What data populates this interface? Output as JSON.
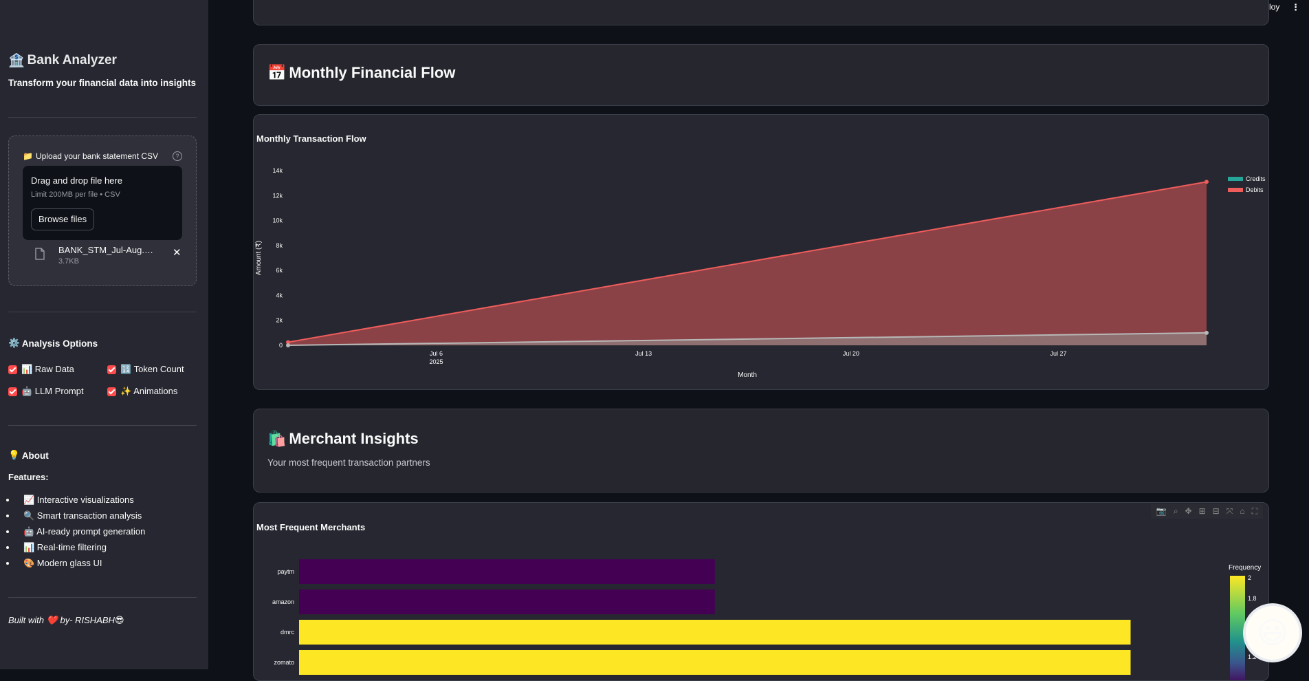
{
  "app": {
    "deploy_label": "Deploy",
    "menu_icon": "⋮"
  },
  "sidebar": {
    "title_icon": "🏦",
    "title": "Bank Analyzer",
    "subtitle": "Transform your financial data into insights",
    "uploader": {
      "label_icon": "📁",
      "label": "Upload your bank statement CSV",
      "help_icon": "?",
      "drop_title": "Drag and drop file here",
      "drop_limit": "Limit 200MB per file • CSV",
      "browse_label": "Browse files",
      "file_name": "BANK_STM_Jul-Aug.CSV",
      "file_size": "3.7KB",
      "remove_icon": "✕"
    },
    "analysis": {
      "icon": "⚙️",
      "title": "Analysis Options",
      "options": [
        {
          "label": "📊 Raw Data",
          "checked": true
        },
        {
          "label": "🔢 Token Count",
          "checked": true
        },
        {
          "label": "🤖 LLM Prompt",
          "checked": true
        },
        {
          "label": "✨ Animations",
          "checked": true
        }
      ]
    },
    "about": {
      "icon": "💡",
      "title": "About",
      "features_label": "Features:",
      "features": [
        "📈 Interactive visualizations",
        "🔍 Smart transaction analysis",
        "🤖 AI-ready prompt generation",
        "📊 Real-time filtering",
        "🎨 Modern glass UI"
      ]
    },
    "footer": {
      "text_a": "Built with",
      "heart": "❤️",
      "text_b": "by- RISHABH",
      "emoji": "😎"
    }
  },
  "main": {
    "monthly_header": {
      "icon": "📅",
      "title": "Monthly Financial Flow"
    },
    "merchant_header": {
      "icon": "🛍️",
      "title": "Merchant Insights",
      "subtitle": "Your most frequent transaction partners"
    },
    "fab_emoji": "😃"
  },
  "chart_data": [
    {
      "type": "area",
      "title": "Monthly Transaction Flow",
      "xlabel": "Month",
      "ylabel": "Amount (₹)",
      "x_ticks": [
        "Jul 6",
        "Jul 13",
        "Jul 20",
        "Jul 27"
      ],
      "x_tick_year": "2025",
      "x_range": [
        "2025-07-01",
        "2025-08-01"
      ],
      "y_ticks": [
        "0",
        "2k",
        "4k",
        "6k",
        "8k",
        "10k",
        "12k",
        "14k"
      ],
      "ylim": [
        0,
        14000
      ],
      "x": [
        "2025-07-01",
        "2025-08-01"
      ],
      "series": [
        {
          "name": "Credits",
          "values": [
            0,
            1000
          ],
          "color": "#b8b8b8"
        },
        {
          "name": "Debits",
          "values": [
            250,
            13100
          ],
          "color": "#ef5c5c"
        }
      ],
      "legend": "top-right",
      "grid": false
    },
    {
      "type": "bar",
      "orientation": "horizontal",
      "title": "Most Frequent Merchants",
      "categories": [
        "paytm",
        "amazon",
        "dmrc",
        "zomato"
      ],
      "values": [
        1,
        1,
        2,
        2
      ],
      "xlim": [
        0,
        2.1
      ],
      "colorbar": {
        "title": "Frequency",
        "ticks": [
          "2",
          "1.8",
          "1.2"
        ],
        "low_color": "#440154",
        "high_color": "#fde725"
      },
      "toolbar_icons": [
        "camera-icon",
        "zoom-icon",
        "pan-icon",
        "zoom-in-icon",
        "zoom-out-icon",
        "autoscale-icon",
        "home-icon",
        "fullscreen-icon"
      ]
    }
  ]
}
